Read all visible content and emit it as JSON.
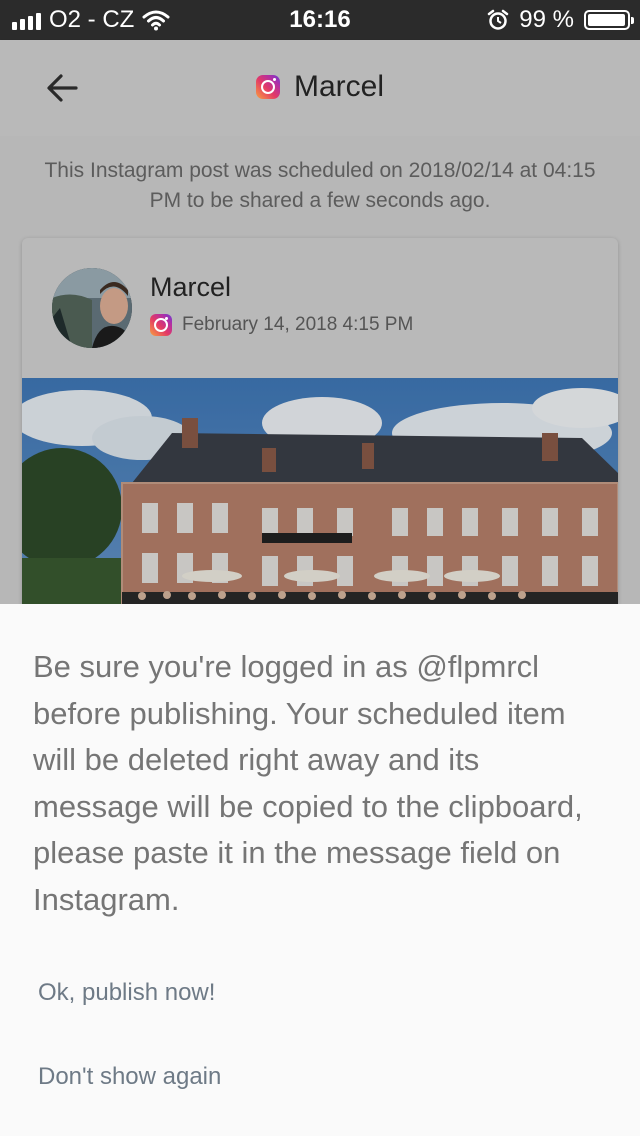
{
  "status_bar": {
    "carrier": "O2 - CZ",
    "time": "16:16",
    "battery": "99 %"
  },
  "header": {
    "title": "Marcel",
    "back_icon": "arrow-left-icon",
    "network_icon": "instagram-icon"
  },
  "info_text": "This Instagram post was scheduled on 2018/02/14 at 04:15 PM to be shared a few seconds ago.",
  "post": {
    "author": "Marcel",
    "timestamp": "February 14, 2018 4:15 PM",
    "network_icon": "instagram-icon"
  },
  "sheet": {
    "message": "Be sure you're logged in as @flpmrcl before publishing. Your scheduled item will be deleted right away and its message will be copied to the clipboard, please paste it in the message field on Instagram.",
    "publish_label": "Ok, publish now!",
    "dont_show_label": "Don't show again"
  },
  "colors": {
    "overlay": "#b7b7b7",
    "sheet_background": "#fafafa",
    "action_text": "#6e7a86"
  }
}
